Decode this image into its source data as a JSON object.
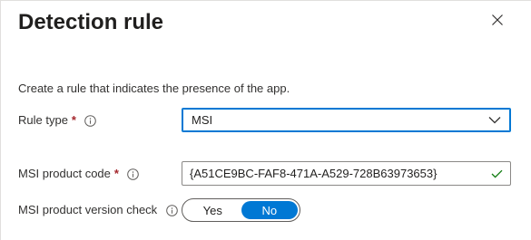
{
  "panel": {
    "title": "Detection rule",
    "description": "Create a rule that indicates the presence of the app."
  },
  "fields": {
    "rule_type": {
      "label": "Rule type",
      "required_marker": "*",
      "info_icon": "info-icon",
      "selected_value": "MSI"
    },
    "msi_product_code": {
      "label": "MSI product code",
      "required_marker": "*",
      "info_icon": "info-icon",
      "value": "{A51CE9BC-FAF8-471A-A529-728B63973653}",
      "status_icon": "checkmark-icon"
    },
    "msi_version_check": {
      "label": "MSI product version check",
      "info_icon": "info-icon",
      "options": [
        "Yes",
        "No"
      ],
      "selected": "No"
    }
  },
  "icons": {
    "close": "close-icon",
    "dropdown": "chevron-down-icon"
  },
  "colors": {
    "accent": "#0078d4",
    "required": "#a4262c",
    "valid": "#107c10"
  }
}
